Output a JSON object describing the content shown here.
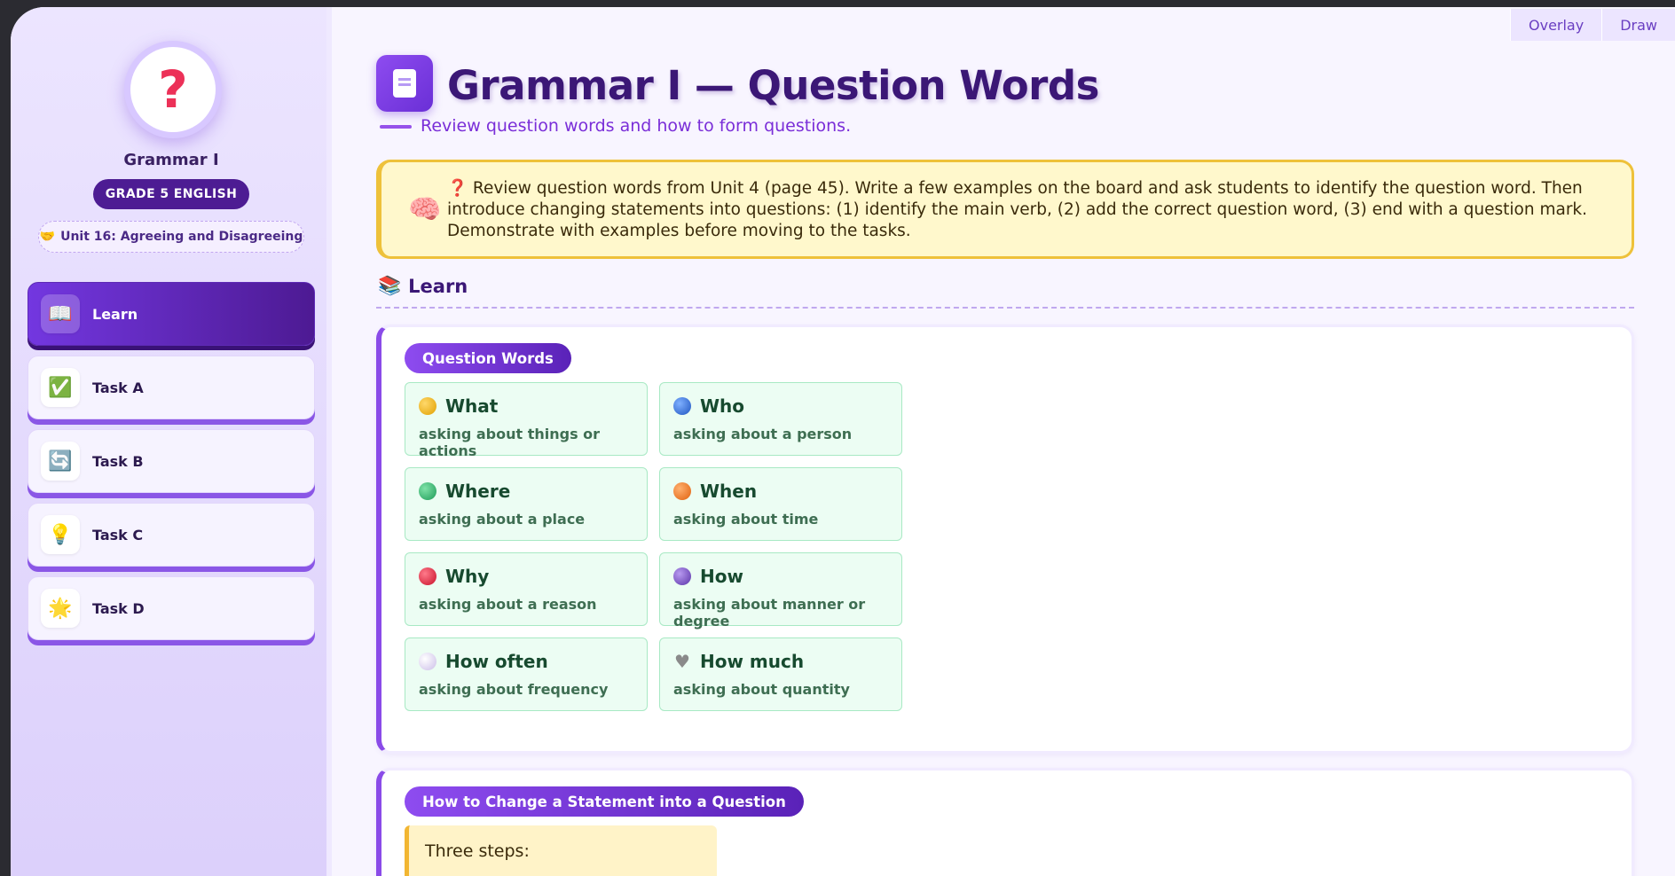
{
  "sidebar": {
    "avatar_glyph": "?",
    "title": "Grammar I",
    "grade": "GRADE 5 ENGLISH",
    "unit_icon": "🤝",
    "unit": "Unit 16: Agreeing and Disagreeing",
    "items": [
      {
        "label": "Learn",
        "icon": "📖",
        "icon_name": "book-icon",
        "active": true
      },
      {
        "label": "Task A",
        "icon": "✅",
        "icon_name": "check-icon",
        "active": false
      },
      {
        "label": "Task B",
        "icon": "🔄",
        "icon_name": "refresh-icon",
        "active": false
      },
      {
        "label": "Task C",
        "icon": "💡",
        "icon_name": "lightbulb-icon",
        "active": false
      },
      {
        "label": "Task D",
        "icon": "🌟",
        "icon_name": "star-icon",
        "active": false
      }
    ]
  },
  "toolbar": {
    "overlay_label": "Overlay",
    "draw_label": "Draw"
  },
  "header": {
    "title": "Grammar I — Question Words",
    "subtitle": "Review question words and how to form questions."
  },
  "note": {
    "icon": "🧠",
    "text": "❓ Review question words from Unit 4 (page 45). Write a few examples on the board and ask students to identify the question word. Then introduce changing statements into questions: (1) identify the main verb, (2) add the correct question word, (3) end with a question mark. Demonstrate with examples before moving to the tasks."
  },
  "learn": {
    "icon": "📚",
    "heading": "Learn"
  },
  "question_words_card": {
    "pill": "Question Words",
    "words": [
      {
        "word": "What",
        "desc": "asking about things or actions",
        "color": "#f2b21c"
      },
      {
        "word": "Who",
        "desc": "asking about a person",
        "color": "#2f6fd8"
      },
      {
        "word": "Where",
        "desc": "asking about a place",
        "color": "#2bb36a"
      },
      {
        "word": "When",
        "desc": "asking about time",
        "color": "#f07a1e"
      },
      {
        "word": "Why",
        "desc": "asking about a reason",
        "color": "#e0263a"
      },
      {
        "word": "How",
        "desc": "asking about manner or degree",
        "color": "#7a4fc8"
      },
      {
        "word": "How often",
        "desc": "asking about frequency",
        "color": "#e2d8f6"
      },
      {
        "word": "How much",
        "desc": "asking about quantity",
        "color": "#8a8a8a"
      }
    ]
  },
  "statement_card": {
    "pill": "How to Change a Statement into a Question",
    "steps_label": "Three steps:"
  },
  "colors": {
    "accent": "#7a3fe0",
    "accent_dark": "#4d1c93",
    "note_bg": "#fff8cc",
    "note_border": "#eec13a",
    "word_bg": "#ecfdf3"
  }
}
